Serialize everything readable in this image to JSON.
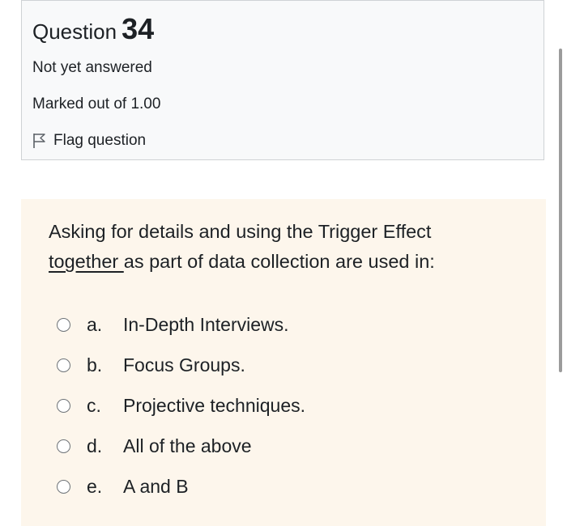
{
  "question_info": {
    "question_word": "Question",
    "question_number": "34",
    "state": "Not yet answered",
    "grade": "Marked out of 1.00",
    "flag_label": "Flag question",
    "flag_icon": "flag-icon"
  },
  "question": {
    "text_part1": "Asking for details and using the Trigger Effect ",
    "text_underlined": "together ",
    "text_part2": "as part of data collection are used in:"
  },
  "answers": [
    {
      "letter": "a.",
      "label": "In-Depth Interviews."
    },
    {
      "letter": "b.",
      "label": "Focus Groups."
    },
    {
      "letter": "c.",
      "label": "Projective techniques."
    },
    {
      "letter": "d.",
      "label": "All of the above"
    },
    {
      "letter": "e.",
      "label": "A and B"
    }
  ],
  "colors": {
    "info_background": "#f8f9fa",
    "content_background": "#fdf6ec",
    "text": "#1d2125"
  }
}
